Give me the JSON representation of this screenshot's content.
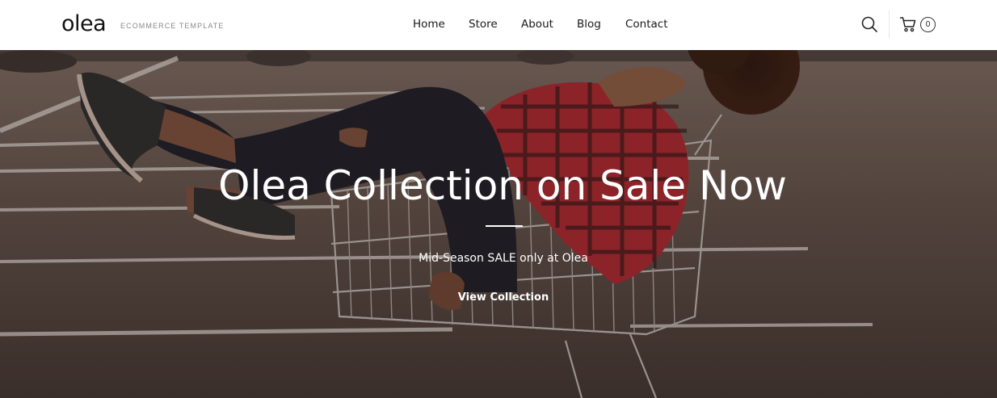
{
  "brand": {
    "logo": "olea",
    "tagline": "ECOMMERCE TEMPLATE"
  },
  "nav": {
    "items": [
      {
        "label": "Home"
      },
      {
        "label": "Store"
      },
      {
        "label": "About"
      },
      {
        "label": "Blog"
      },
      {
        "label": "Contact"
      }
    ]
  },
  "header_actions": {
    "search_icon": "search-icon",
    "cart_icon": "cart-icon",
    "cart_count": "0"
  },
  "hero": {
    "title": "Olea Collection on Sale Now",
    "subtitle": "Mid-Season SALE only at Olea",
    "cta_label": "View Collection",
    "image": "woman-in-shopping-cart-photo"
  },
  "colors": {
    "header_bg": "#ffffff",
    "text_dark": "#111111",
    "tagline_gray": "#8a8a8a",
    "hero_text": "#ffffff"
  }
}
